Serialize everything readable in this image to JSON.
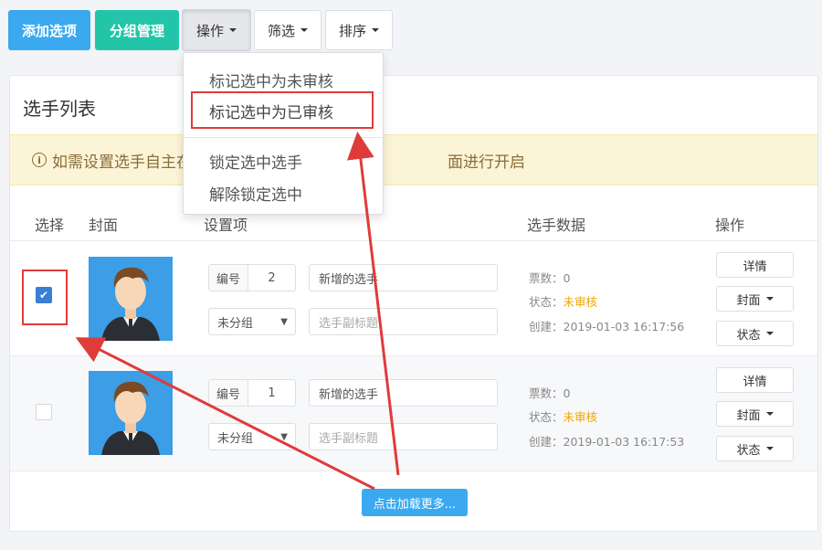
{
  "toolbar": {
    "add_label": "添加选项",
    "group_label": "分组管理",
    "op_label": "操作",
    "filter_label": "筛选",
    "sort_label": "排序"
  },
  "dropdown": {
    "items": [
      "标记选中为未审核",
      "标记选中为已审核",
      "锁定选中选手",
      "解除锁定选中"
    ]
  },
  "panel": {
    "title": "选手列表",
    "alert_icon": "i",
    "alert_left": "如需设置选手自主在",
    "alert_right": "面进行开启"
  },
  "table": {
    "headers": [
      "选择",
      "封面",
      "设置项",
      "选手数据",
      "操作"
    ],
    "rows": [
      {
        "checked": true,
        "number_label": "编号",
        "number": "2",
        "name": "新增的选手",
        "group": "未分组",
        "subtitle_placeholder": "选手副标题",
        "votes": "票数：0",
        "status_prefix": "状态：",
        "status": "未审核",
        "created": "创建：2019-01-03 16:17:56",
        "btn_detail": "详情",
        "btn_cover": "封面",
        "btn_state": "状态"
      },
      {
        "checked": false,
        "number_label": "编号",
        "number": "1",
        "name": "新增的选手",
        "group": "未分组",
        "subtitle_placeholder": "选手副标题",
        "votes": "票数：0",
        "status_prefix": "状态：",
        "status": "未审核",
        "created": "创建：2019-01-03 16:17:53",
        "btn_detail": "详情",
        "btn_cover": "封面",
        "btn_state": "状态"
      }
    ]
  },
  "load_more": "点击加载更多...",
  "colors": {
    "accent_blue": "#3aa9ef",
    "accent_teal": "#23c5a8",
    "annotation_red": "#e03b3b",
    "warn": "#f0a500"
  }
}
